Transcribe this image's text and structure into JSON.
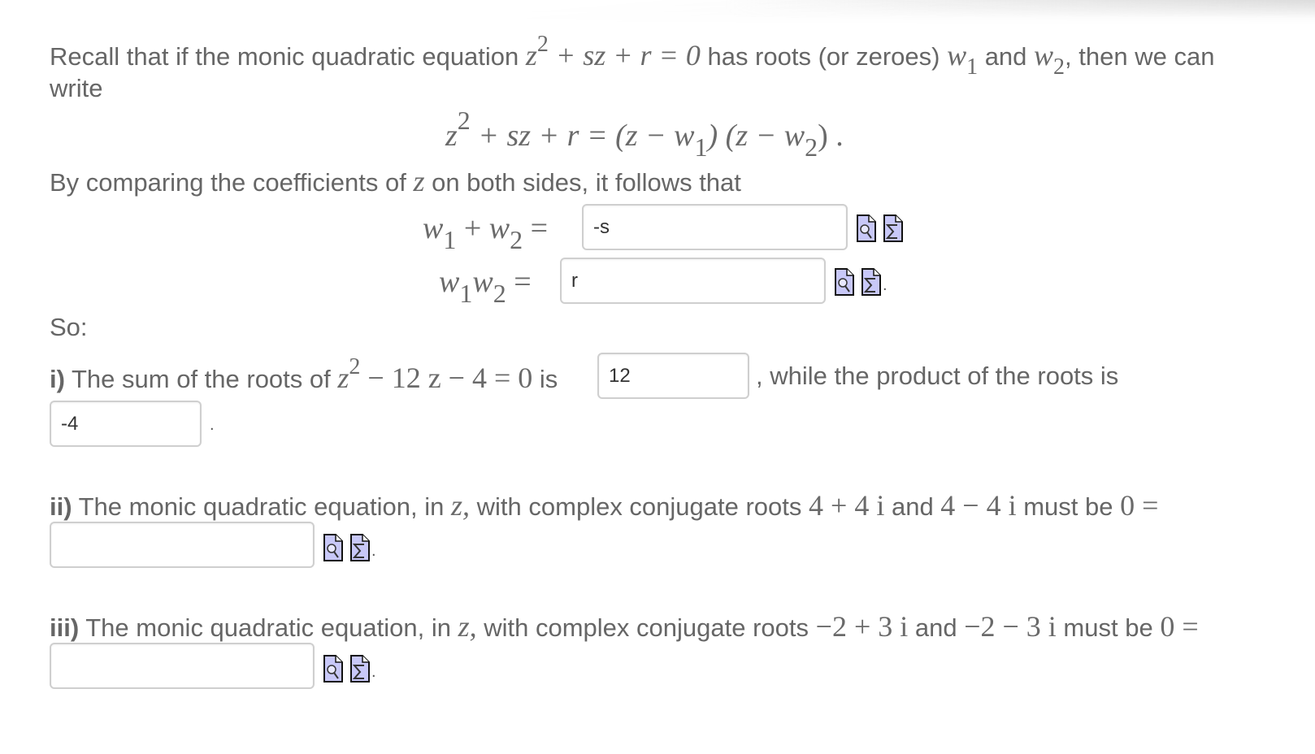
{
  "intro": {
    "text1": "Recall that if the monic quadratic equation ",
    "eq": {
      "z": "z",
      "exp": "2",
      "rest": " + sz + r = 0"
    },
    "text2": " has roots (or zeroes) ",
    "w": "w",
    "sub1": "1",
    "and": " and ",
    "sub2": "2",
    "text3": ", then we can",
    "text4": "write"
  },
  "display_eq": {
    "lhs_z": "z",
    "lhs_exp": "2",
    "lhs_rest": " + sz + r = (z − w",
    "sub1": "1",
    "mid": ") (z − w",
    "sub2": "2",
    "end": ") ."
  },
  "comparing": {
    "text1": "By comparing the coefficients of ",
    "var": "z",
    "text2": " on both sides, it follows that"
  },
  "sum_row": {
    "w": "w",
    "sub1": "1",
    "plus": " + ",
    "sub2": "2",
    "equals": " =",
    "input_value": "-s"
  },
  "product_row": {
    "w": "w",
    "sub1": "1",
    "sub2": "2",
    "equals": " =",
    "input_value": "r"
  },
  "so_label": "So:",
  "part_i": {
    "label": "i)",
    "text1": " The sum of the roots of ",
    "eq_z": "z",
    "eq_exp": "2",
    "eq_rest": " − 12 z − 4 = 0",
    "is": " is",
    "sum_value": "12",
    "text2": ", while the product of the roots is",
    "product_value": "-4",
    "period": "."
  },
  "part_ii": {
    "label": "ii)",
    "text1": " The monic quadratic equation, in ",
    "var": "z,",
    "text2": "  with complex conjugate roots ",
    "root1": "4 + 4 i",
    "and": "  and ",
    "root2": "4 − 4 i",
    "text3": "  must be ",
    "eq": "0 =",
    "input_value": "",
    "period": "."
  },
  "part_iii": {
    "label": "iii)",
    "text1": " The monic quadratic equation, in ",
    "var": "z,",
    "text2": "  with complex conjugate roots ",
    "root1": "−2 + 3 i",
    "and": "  and ",
    "root2": "−2 − 3 i",
    "text3": "  must be ",
    "eq": "0 =",
    "input_value": "",
    "period": "."
  },
  "icons": {
    "preview": "preview-answer-icon",
    "equation_editor": "equation-editor-icon"
  },
  "colors": {
    "text": "#666666",
    "icon_fill": "#c8c8f8",
    "field_border": "#cfcfcf"
  }
}
